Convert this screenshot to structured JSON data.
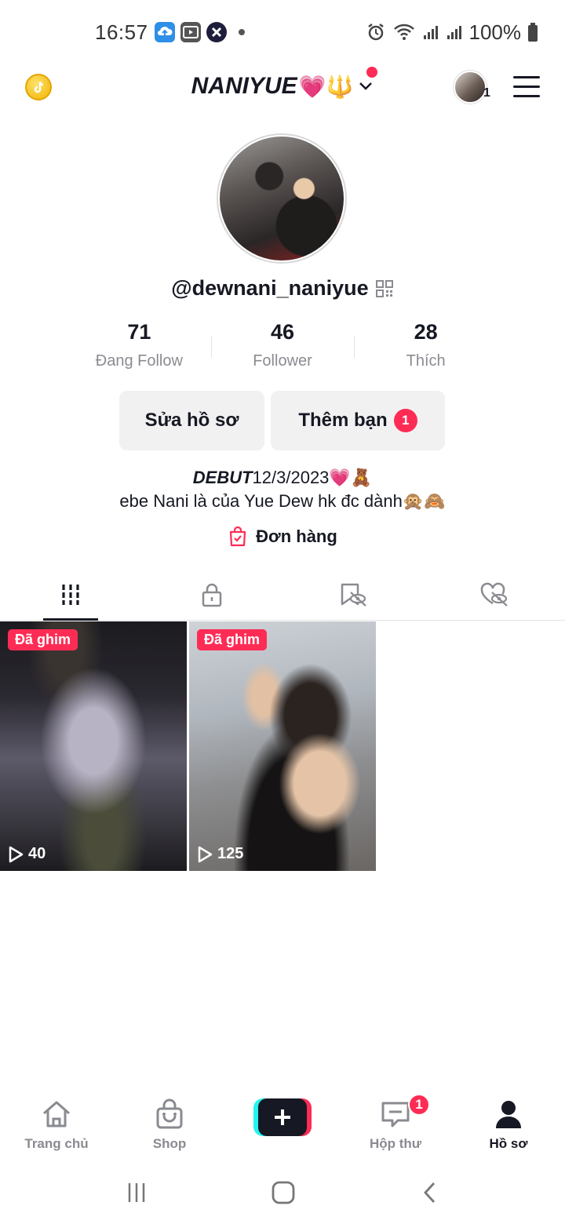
{
  "status_bar": {
    "time": "16:57",
    "battery_text": "100%",
    "icons": [
      "cloud-upload-icon",
      "video-icon",
      "x-app-icon",
      "alarm-icon",
      "wifi-icon",
      "signal-icon",
      "signal-icon",
      "battery-icon"
    ]
  },
  "header": {
    "display_name": "NANIYUE",
    "display_name_emoji": "💗🔱",
    "account_count": "1"
  },
  "profile": {
    "username": "@dewnani_naniyue",
    "stats": [
      {
        "value": "71",
        "label": "Đang Follow"
      },
      {
        "value": "46",
        "label": "Follower"
      },
      {
        "value": "28",
        "label": "Thích"
      }
    ],
    "edit_button": "Sửa hồ sơ",
    "add_friend_button": "Thêm bạn",
    "add_friend_badge": "1",
    "bio_debut": "DEBUT",
    "bio_line1_rest": "12/3/2023💗🧸",
    "bio_line2": "ebe Nani là của Yue Dew hk đc dành🙊🙈",
    "orders_label": "Đơn hàng"
  },
  "tabs": [
    {
      "icon": "grid-icon",
      "active": true
    },
    {
      "icon": "lock-icon",
      "active": false
    },
    {
      "icon": "bookmark-hidden-icon",
      "active": false
    },
    {
      "icon": "heart-hidden-icon",
      "active": false
    }
  ],
  "videos": [
    {
      "pinned_label": "Đã ghim",
      "views": "40"
    },
    {
      "pinned_label": "Đã ghim",
      "views": "125"
    }
  ],
  "bottom_nav": {
    "home": "Trang chủ",
    "shop": "Shop",
    "inbox": "Hộp thư",
    "inbox_badge": "1",
    "profile": "Hồ sơ"
  },
  "colors": {
    "accent": "#fe2c55",
    "cyan": "#25f4ee",
    "text": "#161823",
    "muted": "#8a8b91"
  }
}
